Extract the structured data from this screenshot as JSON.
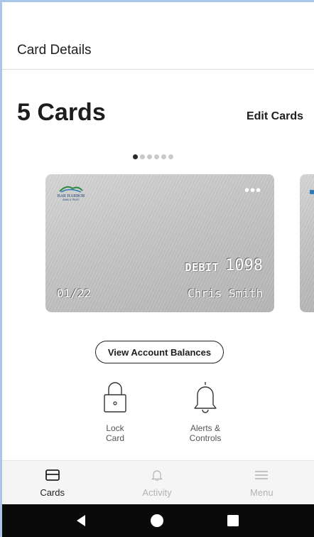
{
  "header": {
    "title": "Card Details"
  },
  "cards_section": {
    "count_title": "5 Cards",
    "edit_label": "Edit Cards",
    "total_pages": 6,
    "active_page": 1
  },
  "card": {
    "bank_logo": "BAR HARBOR BANK & TRUST",
    "menu_icon": "more-horizontal-icon",
    "type": "DEBIT",
    "last4": "1098",
    "expiry": "01/22",
    "holder": "Chris Smith"
  },
  "actions": {
    "balances_label": "View Account Balances",
    "lock_label": "Lock\nCard",
    "alerts_label": "Alerts &\nControls"
  },
  "tabbar": {
    "items": [
      {
        "label": "Cards",
        "icon": "card-icon",
        "active": true
      },
      {
        "label": "Activity",
        "icon": "bell-icon",
        "active": false
      },
      {
        "label": "Menu",
        "icon": "menu-icon",
        "active": false
      }
    ]
  },
  "navbar": {
    "back_icon": "back-triangle-icon",
    "home_icon": "home-circle-icon",
    "recents_icon": "recents-square-icon"
  },
  "colors": {
    "accent_dark": "#1d1d1d",
    "card_silver": "#c6c6c6",
    "tab_inactive": "#b3b3b3",
    "navbar": "#0a0a0a"
  }
}
